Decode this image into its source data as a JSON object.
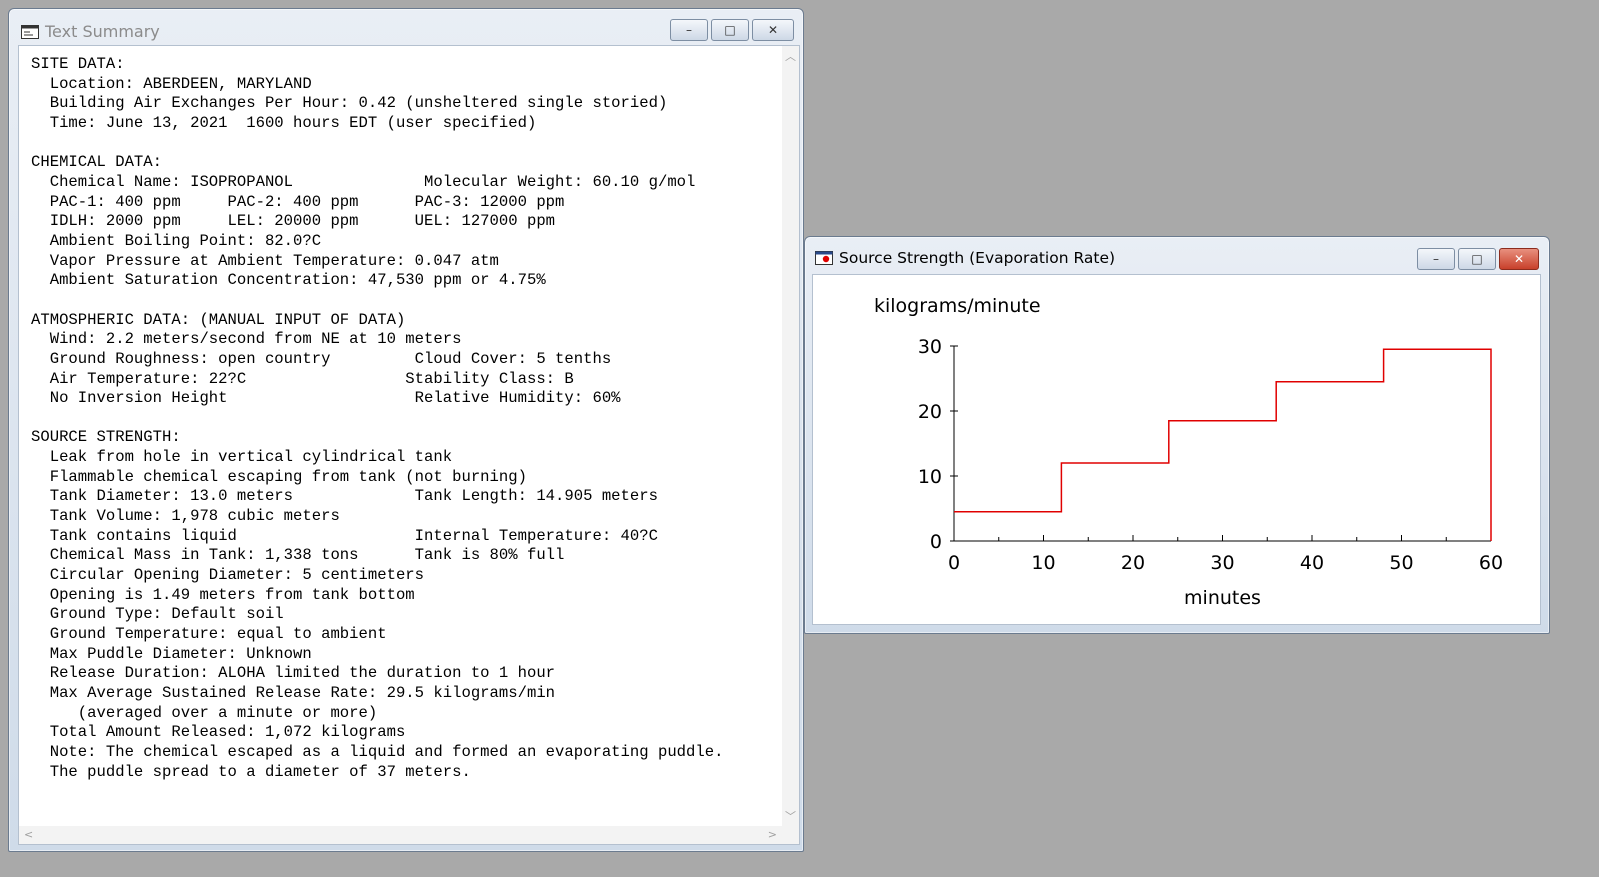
{
  "summary_window": {
    "title": "Text Summary",
    "lines": [
      "SITE DATA:",
      "  Location: ABERDEEN, MARYLAND",
      "  Building Air Exchanges Per Hour: 0.42 (unsheltered single storied)",
      "  Time: June 13, 2021  1600 hours EDT (user specified)",
      "",
      "CHEMICAL DATA:",
      "  Chemical Name: ISOPROPANOL              Molecular Weight: 60.10 g/mol",
      "  PAC-1: 400 ppm     PAC-2: 400 ppm      PAC-3: 12000 ppm",
      "  IDLH: 2000 ppm     LEL: 20000 ppm      UEL: 127000 ppm",
      "  Ambient Boiling Point: 82.0?C",
      "  Vapor Pressure at Ambient Temperature: 0.047 atm",
      "  Ambient Saturation Concentration: 47,530 ppm or 4.75%",
      "",
      "ATMOSPHERIC DATA: (MANUAL INPUT OF DATA)",
      "  Wind: 2.2 meters/second from NE at 10 meters",
      "  Ground Roughness: open country         Cloud Cover: 5 tenths",
      "  Air Temperature: 22?C                 Stability Class: B",
      "  No Inversion Height                    Relative Humidity: 60%",
      "",
      "SOURCE STRENGTH:",
      "  Leak from hole in vertical cylindrical tank",
      "  Flammable chemical escaping from tank (not burning)",
      "  Tank Diameter: 13.0 meters             Tank Length: 14.905 meters",
      "  Tank Volume: 1,978 cubic meters",
      "  Tank contains liquid                   Internal Temperature: 40?C",
      "  Chemical Mass in Tank: 1,338 tons      Tank is 80% full",
      "  Circular Opening Diameter: 5 centimeters",
      "  Opening is 1.49 meters from tank bottom",
      "  Ground Type: Default soil",
      "  Ground Temperature: equal to ambient",
      "  Max Puddle Diameter: Unknown",
      "  Release Duration: ALOHA limited the duration to 1 hour",
      "  Max Average Sustained Release Rate: 29.5 kilograms/min",
      "     (averaged over a minute or more)",
      "  Total Amount Released: 1,072 kilograms",
      "  Note: The chemical escaped as a liquid and formed an evaporating puddle.",
      "  The puddle spread to a diameter of 37 meters."
    ]
  },
  "graph_window": {
    "title": "Source Strength (Evaporation Rate)"
  },
  "window_buttons": {
    "minimize": "–",
    "maximize": "□",
    "close": "✕"
  },
  "colors": {
    "desktop": "#a9a9a9",
    "series_line": "#e00000"
  },
  "chart_data": {
    "type": "line",
    "step": true,
    "ylabel": "kilograms/minute",
    "xlabel": "minutes",
    "xlim": [
      0,
      60
    ],
    "ylim": [
      0,
      30
    ],
    "x_ticks": [
      0,
      10,
      20,
      30,
      40,
      50,
      60
    ],
    "y_ticks": [
      0,
      10,
      20,
      30
    ],
    "grid": false,
    "series": [
      {
        "color": "#e00000",
        "points": [
          [
            0,
            4.5
          ],
          [
            12,
            4.5
          ],
          [
            12,
            12
          ],
          [
            24,
            12
          ],
          [
            24,
            18.5
          ],
          [
            36,
            18.5
          ],
          [
            36,
            24.5
          ],
          [
            48,
            24.5
          ],
          [
            48,
            29.5
          ],
          [
            60,
            29.5
          ],
          [
            60,
            0
          ]
        ]
      }
    ]
  }
}
